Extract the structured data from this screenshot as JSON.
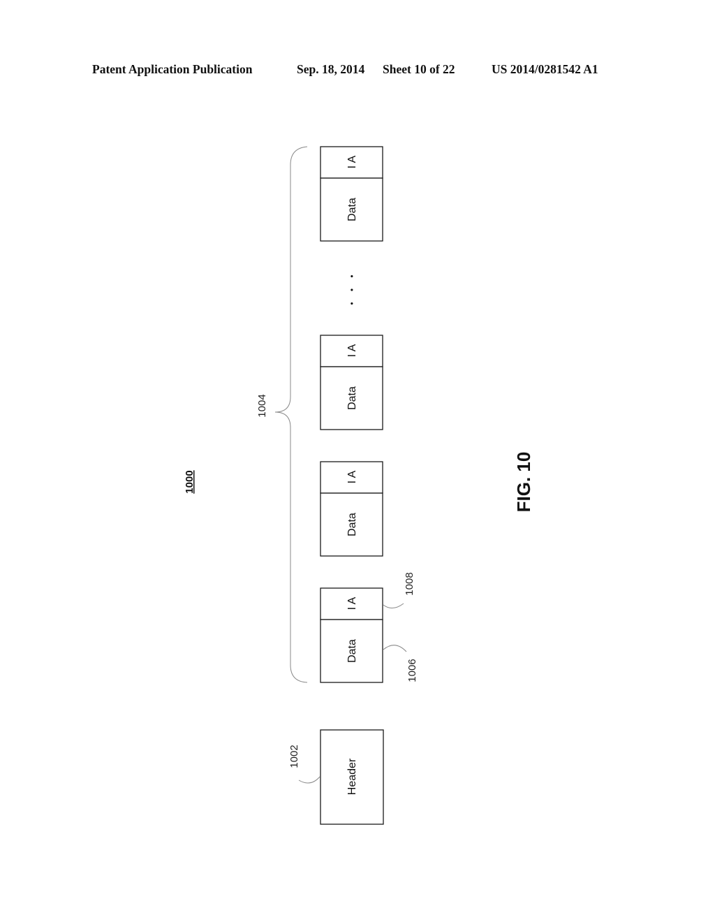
{
  "header": {
    "publication": "Patent Application Publication",
    "date": "Sep. 18, 2014",
    "sheet": "Sheet 10 of 22",
    "number": "US 2014/0281542 A1"
  },
  "diagram": {
    "figure_number": "1000",
    "figure_caption": "FIG. 10",
    "header_block": {
      "label": "Header",
      "ref": "1002"
    },
    "group_ref": "1004",
    "data_label_ref": "1006",
    "ia_label_ref": "1008",
    "ellipsis": "• • •",
    "packets": [
      {
        "data_label": "Data",
        "ia_label": "I A"
      },
      {
        "data_label": "Data",
        "ia_label": "I A"
      },
      {
        "data_label": "Data",
        "ia_label": "I A"
      },
      {
        "data_label": "Data",
        "ia_label": "I A"
      }
    ]
  }
}
